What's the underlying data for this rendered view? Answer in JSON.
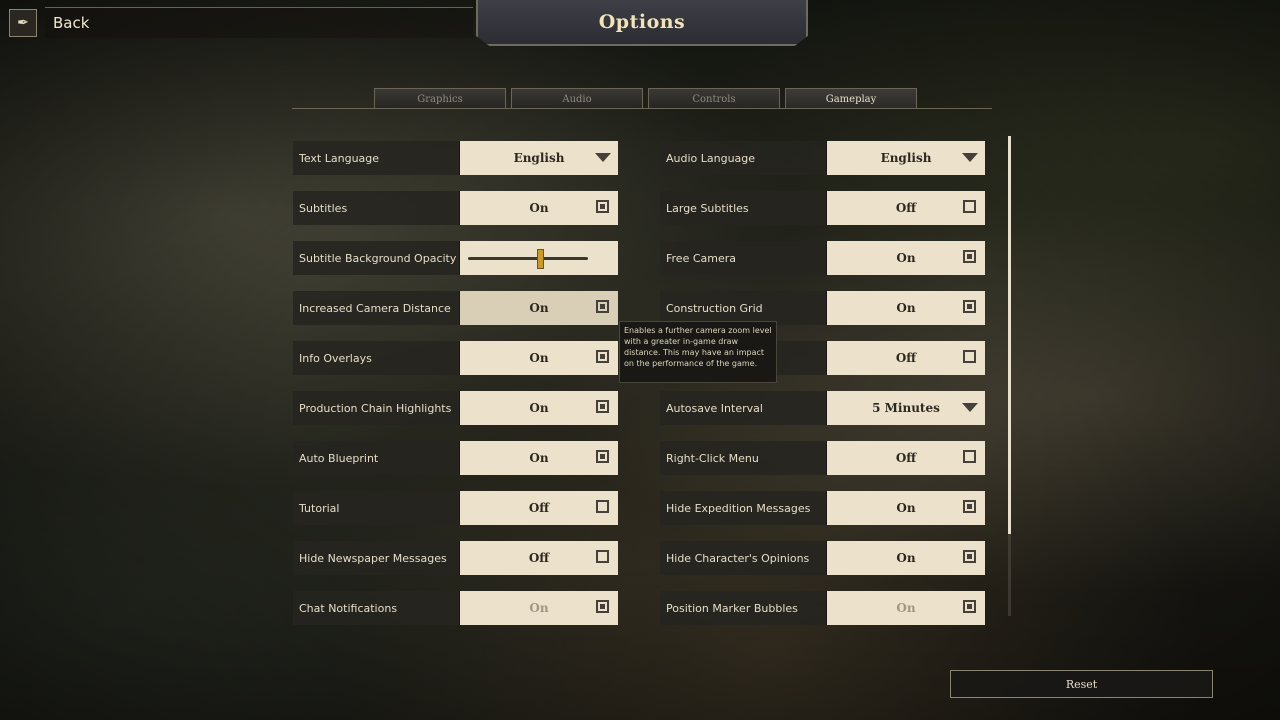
{
  "header": {
    "back_label": "Back",
    "title": "Options",
    "back_icon": "quill-icon"
  },
  "tabs": [
    "Graphics",
    "Audio",
    "Controls",
    "Gameplay"
  ],
  "active_tab": "Gameplay",
  "left_settings": [
    {
      "label": "Text Language",
      "type": "dropdown",
      "value": "English"
    },
    {
      "label": "Subtitles",
      "type": "toggle",
      "value": "On",
      "checked": true
    },
    {
      "label": "Subtitle Background Opacity",
      "type": "slider",
      "level": 0.6
    },
    {
      "label": "Increased Camera Distance",
      "type": "toggle",
      "value": "On",
      "checked": true,
      "hover": true
    },
    {
      "label": "Info Overlays",
      "type": "toggle",
      "value": "On",
      "checked": true
    },
    {
      "label": "Production Chain Highlights",
      "type": "toggle",
      "value": "On",
      "checked": true
    },
    {
      "label": "Auto Blueprint",
      "type": "toggle",
      "value": "On",
      "checked": true
    },
    {
      "label": "Tutorial",
      "type": "toggle",
      "value": "Off",
      "checked": false
    },
    {
      "label": "Hide Newspaper Messages",
      "type": "toggle",
      "value": "Off",
      "checked": false
    },
    {
      "label": "Chat Notifications",
      "type": "toggle",
      "value": "On",
      "checked": true,
      "dim": true
    }
  ],
  "right_settings": [
    {
      "label": "Audio Language",
      "type": "dropdown",
      "value": "English"
    },
    {
      "label": "Large Subtitles",
      "type": "toggle",
      "value": "Off",
      "checked": false
    },
    {
      "label": "Free Camera",
      "type": "toggle",
      "value": "On",
      "checked": true
    },
    {
      "label": "Construction Grid",
      "type": "toggle",
      "value": "On",
      "checked": true
    },
    {
      "label": "",
      "type": "toggle",
      "value": "Off",
      "checked": false
    },
    {
      "label": "Autosave Interval",
      "type": "dropdown",
      "value": "5 Minutes"
    },
    {
      "label": "Right-Click Menu",
      "type": "toggle",
      "value": "Off",
      "checked": false
    },
    {
      "label": "Hide Expedition Messages",
      "type": "toggle",
      "value": "On",
      "checked": true
    },
    {
      "label": "Hide Character's Opinions",
      "type": "toggle",
      "value": "On",
      "checked": true
    },
    {
      "label": "Position Marker Bubbles",
      "type": "toggle",
      "value": "On",
      "checked": true,
      "dim": true
    }
  ],
  "tooltip": "Enables a further camera zoom level with a greater in-game draw distance. This may have an impact on the performance of the game.",
  "reset_label": "Reset",
  "scroll_fraction": 0.83
}
